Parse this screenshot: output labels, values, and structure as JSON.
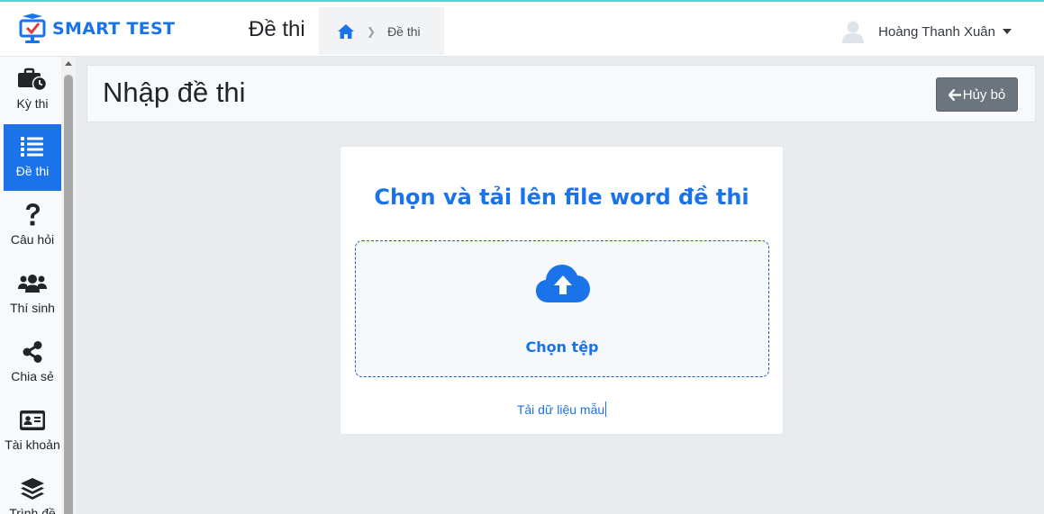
{
  "app": {
    "logo_text": "SMART TEST",
    "page_heading": "Đề thi"
  },
  "breadcrumb": {
    "home_icon": "home-icon",
    "current": "Đề thi"
  },
  "user": {
    "name": "Hoàng Thanh Xuân",
    "avatar_icon": "user-avatar-icon"
  },
  "sidebar": {
    "items": [
      {
        "label": "Kỳ thi",
        "icon": "briefcase-clock-icon",
        "active": false
      },
      {
        "label": "Đề thi",
        "icon": "list-icon",
        "active": true
      },
      {
        "label": "Câu hỏi",
        "icon": "question-icon",
        "active": false
      },
      {
        "label": "Thí sinh",
        "icon": "users-icon",
        "active": false
      },
      {
        "label": "Chia sẻ",
        "icon": "share-icon",
        "active": false
      },
      {
        "label": "Tài khoản",
        "icon": "id-card-icon",
        "active": false
      },
      {
        "label": "Trình đề",
        "icon": "layers-icon",
        "active": false
      }
    ]
  },
  "header": {
    "title": "Nhập đề thi",
    "cancel_label": "Hủy bỏ"
  },
  "upload": {
    "title": "Chọn và tải lên file word đề thi",
    "choose_label": "Chọn tệp",
    "sample_link": "Tải dữ liệu mẫu"
  },
  "colors": {
    "accent": "#1a73e8",
    "button_gray": "#6c757d",
    "background": "#e9ecef"
  }
}
